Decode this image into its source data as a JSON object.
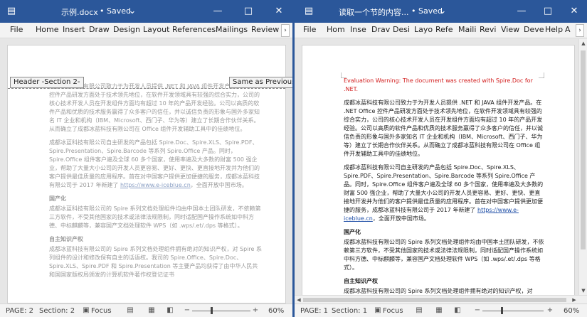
{
  "left": {
    "title": "示例.docx",
    "saved": "• Saved",
    "menu": [
      "File",
      "Home",
      "Insert",
      "Draw",
      "Design",
      "Layout",
      "References",
      "Mailings",
      "Review"
    ],
    "header_tag": "Header -Section 2-",
    "same_as_previous": "Same as Previous",
    "paragraphs": [
      "成都冰蓝科技有限公司致力于为开发人员提供 .NET 和 JAVA 组件开发产品。Office 控件产品研发方面处于技术领先地位，在软件开发领域具有较强的综合实力，公司的核心技术开发人员在开发组件方面均有超过 10 年的产品开发经验。公司以高质的软件产品和优质的技术服务赢得了众多客户的信任，并以诚信负责的形象与国外多家知名 IT 企业和机构（IBM、Microsoft、西门子、华为等）建立了长期合作伙伴关系。从而确立了成都冰蓝科技有限公司在 Office 组件开发辅助工具中的佳绩地位。",
      "成都冰蓝科技有限公司自主研发的产品包括 Spire.Doc、Spire.XLS、Spire.PDF、Spire.Presentation、Spire.Barcode 等系列 Spire.Office 产品。同时，Spire.Office 组件客户遍及全球 60 多个国家，使用率遍及大多数的财富 500 强企业，帮助了大量大小公司的开发人员更容易、更好、更快、更直接地开发并为他们的客户提供最佳质量的应用程序。首在对中国客户提供更加便捷的服务，成都冰蓝科技有限公司于 2017 年新建了",
      "，全面开放中国市场。"
    ],
    "link": "https://www.e-iceblue.cn",
    "h_china": "国产化",
    "p_china": "成都冰蓝科技有限公司的 Spire 系列文档处理组件均由中国本土团队研发，不依赖第三方软件，不受其他国家的技术或法律法规限制，同时适配国产操作系统如中科方德、中标麒麟等，兼容国产文档处理软件 WPS（如 .wps/.et/.dps 等格式）。",
    "h_ip": "自主知识产权",
    "p_ip": "成都冰蓝科技有限公司的 Spire 系列文档处理组件拥有绝对的知识产权，对 Spire 系列组件的设计和修改保有自主的话语权。我司的 Spire.Office、Spire.Doc、Spire.XLS、Spire.PDF 和 Spire.Presentation 等主要产品均获得了由中华人民共和国国家版权局颁发的计算机软件著作权登记证书",
    "status": {
      "page": "PAGE: 2",
      "section": "Section: 2",
      "focus": "Focus",
      "zoom": "60%"
    }
  },
  "right": {
    "title": "读取一个节的内容...",
    "saved": "• Saved",
    "menu": [
      "File",
      "Hom",
      "Inse",
      "Drav",
      "Desi",
      "Layo",
      "Refe",
      "Maili",
      "Revi",
      "View",
      "Deve",
      "Help",
      "A"
    ],
    "warning": "Evaluation Warning: The document was created with Spire.Doc for .NET.",
    "paragraphs": [
      "成都冰蓝科技有限公司致力于为开发人员提供 .NET 和 JAVA 组件开发产品。在 .NET Office 控件产品研发方面处于技术领先地位，在软件开发领域具有较强的综合实力，公司的核心技术开发人员在开发组件方面均有超过 10 年的产品开发经验。公司以高质的软件产品和优质的技术服务赢得了众多客户的信任，并以诚信负责的形象与国外多家知名 IT 企业和机构（IBM、Microsoft、西门子、华为等）建立了长期合作伙伴关系。从而确立了成都冰蓝科技有限公司在 Office 组件开发辅助工具中的佳绩地位。",
      "成都冰蓝科技有限公司自主研发的产品包括 Spire.Doc、Spire.XLS、Spire.PDF、Spire.Presentation、Spire.Barcode 等系列 Spire.Office 产品。同时，Spire.Office 组件客户遍及全球 60 多个国家，使用率遍及大多数的财富 500 强企业，帮助了大量大小公司的开发人员更容易、更好、更快、更直接地开发并为他们的客户提供最佳质量的应用程序。首在对中国客户提供更加便捷的服务，成都冰蓝科技有限公司于 2017 年新建了",
      "，全面开放中国市场。"
    ],
    "link": "https://www.e-iceblue.cn",
    "h_china": "国产化",
    "p_china": "成都冰蓝科技有限公司的 Spire 系列文档处理组件均由中国本土团队研发，不依赖第三方软件，不受其他国家的技术或法律法规限制，同时适配国产操作系统如中科方德、中标麒麟等，兼容国产文档处理软件 WPS（如 .wps/.et/.dps 等格式）。",
    "h_ip": "自主知识产权",
    "p_ip": "成都冰蓝科技有限公司的 Spire 系列文档处理组件拥有绝对的知识产权，对 Spire 系列组件的设计和修改保有自主的话语权。我司的 Spire.Office、Spire.Doc、Spire.XLS、Spire.PDF 和 Spire.Presentation 等主要产品均获得了由中华人民共和国国家版权局颁发的计算机软件著作权登记证书",
    "status": {
      "page": "PAGE: 1",
      "section": "Section: 1",
      "focus": "Focus",
      "zoom": "60%"
    }
  },
  "colors": {
    "title_bar": "#2b579a",
    "warning": "#d21c1c",
    "link": "#1f4fa7"
  },
  "icons": [
    "word-doc-icon",
    "chevron-down-icon",
    "minimize-icon",
    "maximize-icon",
    "close-icon",
    "chevron-right-icon",
    "focus-icon",
    "read-mode-icon",
    "print-layout-icon",
    "web-layout-icon",
    "zoom-out-icon",
    "zoom-in-icon"
  ]
}
